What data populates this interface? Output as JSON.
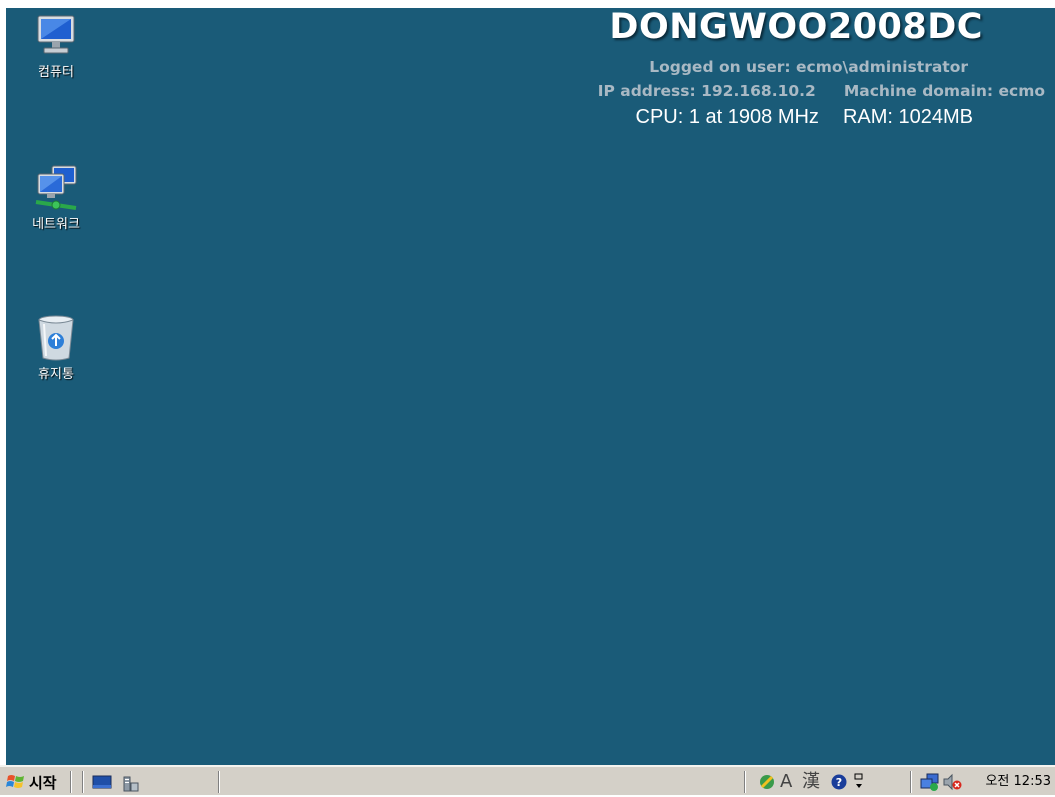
{
  "desktop": {
    "icons": [
      {
        "label": "컴퓨터",
        "icon": "computer-icon"
      },
      {
        "label": "네트워크",
        "icon": "network-icon"
      },
      {
        "label": "휴지통",
        "icon": "recycle-bin-icon"
      }
    ]
  },
  "bginfo": {
    "hostname": "DONGWOO2008DC",
    "logged_on_user": "Logged on user: ecmo\\administrator",
    "ip_address": "IP address: 192.168.10.2",
    "machine_domain": "Machine domain: ecmo",
    "cpu": "CPU: 1 at 1908 MHz",
    "ram": "RAM: 1024MB"
  },
  "taskbar": {
    "start_label": "시작",
    "quick_launch": [
      "show-desktop-icon",
      "server-manager-icon"
    ],
    "tray_icons": [
      "language-bar-icon",
      "text-mode-icon",
      "hanja-icon",
      "help-icon",
      "options-icon",
      "network-status-icon",
      "volume-muted-icon"
    ],
    "tray_text": {
      "ime_a": "A",
      "hanja": "漢"
    },
    "clock": "오전 12:53"
  },
  "colors": {
    "desktop_background": "#1a5b78",
    "taskbar": "#d4d0c8"
  }
}
